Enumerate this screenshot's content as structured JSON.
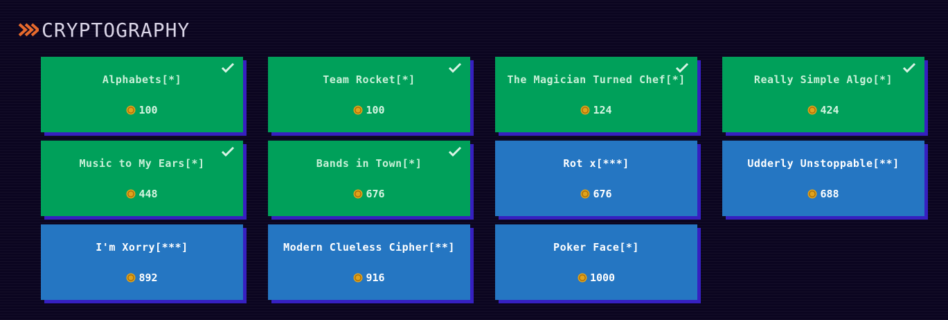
{
  "section": {
    "title": "CRYPTOGRAPHY",
    "icon": "double-chevron-right-icon",
    "icon_color": "#e86a2c"
  },
  "colors": {
    "solved": "#00a05a",
    "unsolved": "#2576c2",
    "shadow": "#3620c0",
    "coin": "#e0a31c"
  },
  "challenges": [
    {
      "name": "Alphabets[*]",
      "points": "100",
      "solved": true
    },
    {
      "name": "Team Rocket[*]",
      "points": "100",
      "solved": true
    },
    {
      "name": "The Magician Turned Chef[*]",
      "points": "124",
      "solved": true
    },
    {
      "name": "Really Simple Algo[*]",
      "points": "424",
      "solved": true
    },
    {
      "name": "Music to My Ears[*]",
      "points": "448",
      "solved": true
    },
    {
      "name": "Bands in Town[*]",
      "points": "676",
      "solved": true
    },
    {
      "name": "Rot x[***]",
      "points": "676",
      "solved": false
    },
    {
      "name": "Udderly Unstoppable[**]",
      "points": "688",
      "solved": false
    },
    {
      "name": "I'm Xorry[***]",
      "points": "892",
      "solved": false
    },
    {
      "name": "Modern Clueless Cipher[**]",
      "points": "916",
      "solved": false
    },
    {
      "name": "Poker Face[*]",
      "points": "1000",
      "solved": false
    }
  ]
}
